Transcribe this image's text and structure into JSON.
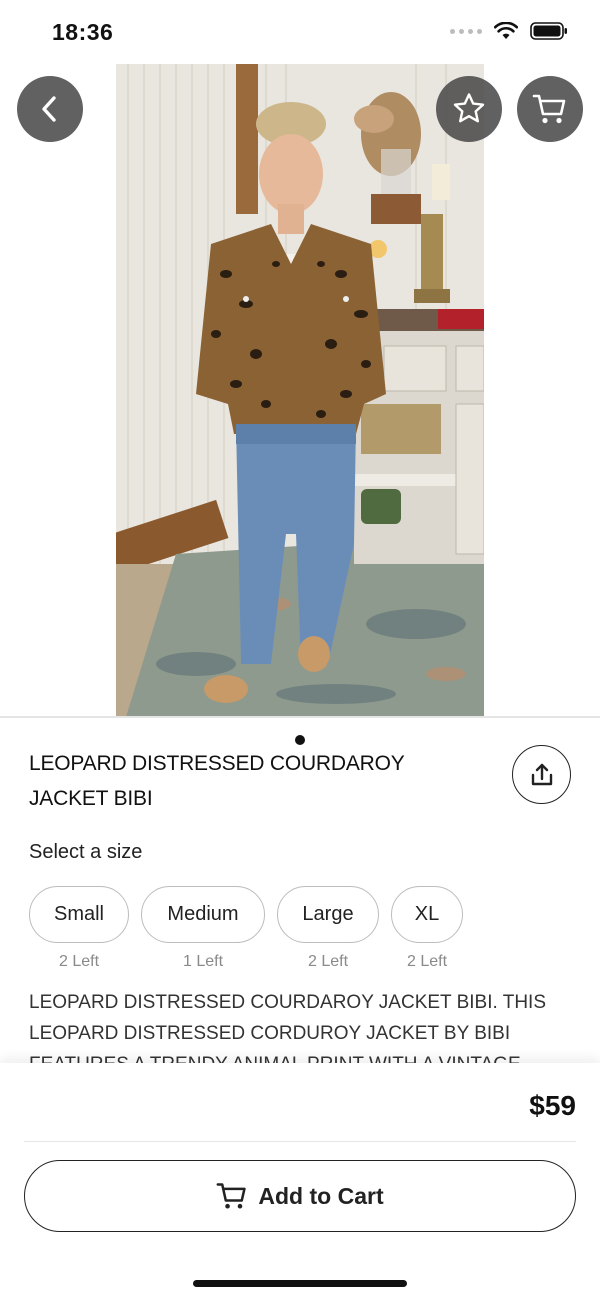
{
  "status_bar": {
    "time": "18:36"
  },
  "product": {
    "title": "LEOPARD DISTRESSED COURDAROY JACKET BIBI",
    "size_prompt": "Select a size",
    "sizes": [
      {
        "label": "Small",
        "stock": "2 Left"
      },
      {
        "label": "Medium",
        "stock": "1 Left"
      },
      {
        "label": "Large",
        "stock": "2 Left"
      },
      {
        "label": "XL",
        "stock": "2 Left"
      }
    ],
    "description": "LEOPARD DISTRESSED COURDAROY JACKET BIBI. THIS LEOPARD DISTRESSED CORDUROY JACKET BY BIBI FEATURES A TRENDY ANIMAL PRINT WITH A VINTAGE",
    "price": "$59",
    "image_pages": 1,
    "image_current_page": 1
  },
  "actions": {
    "add_to_cart": "Add to Cart"
  },
  "icons": {
    "back": "chevron-left-icon",
    "favorite": "star-outline-icon",
    "cart": "shopping-cart-icon",
    "share": "share-upload-icon"
  },
  "colors": {
    "overlay_button": "#4b4b4b",
    "text": "#111111",
    "muted": "#8a8a8a"
  }
}
